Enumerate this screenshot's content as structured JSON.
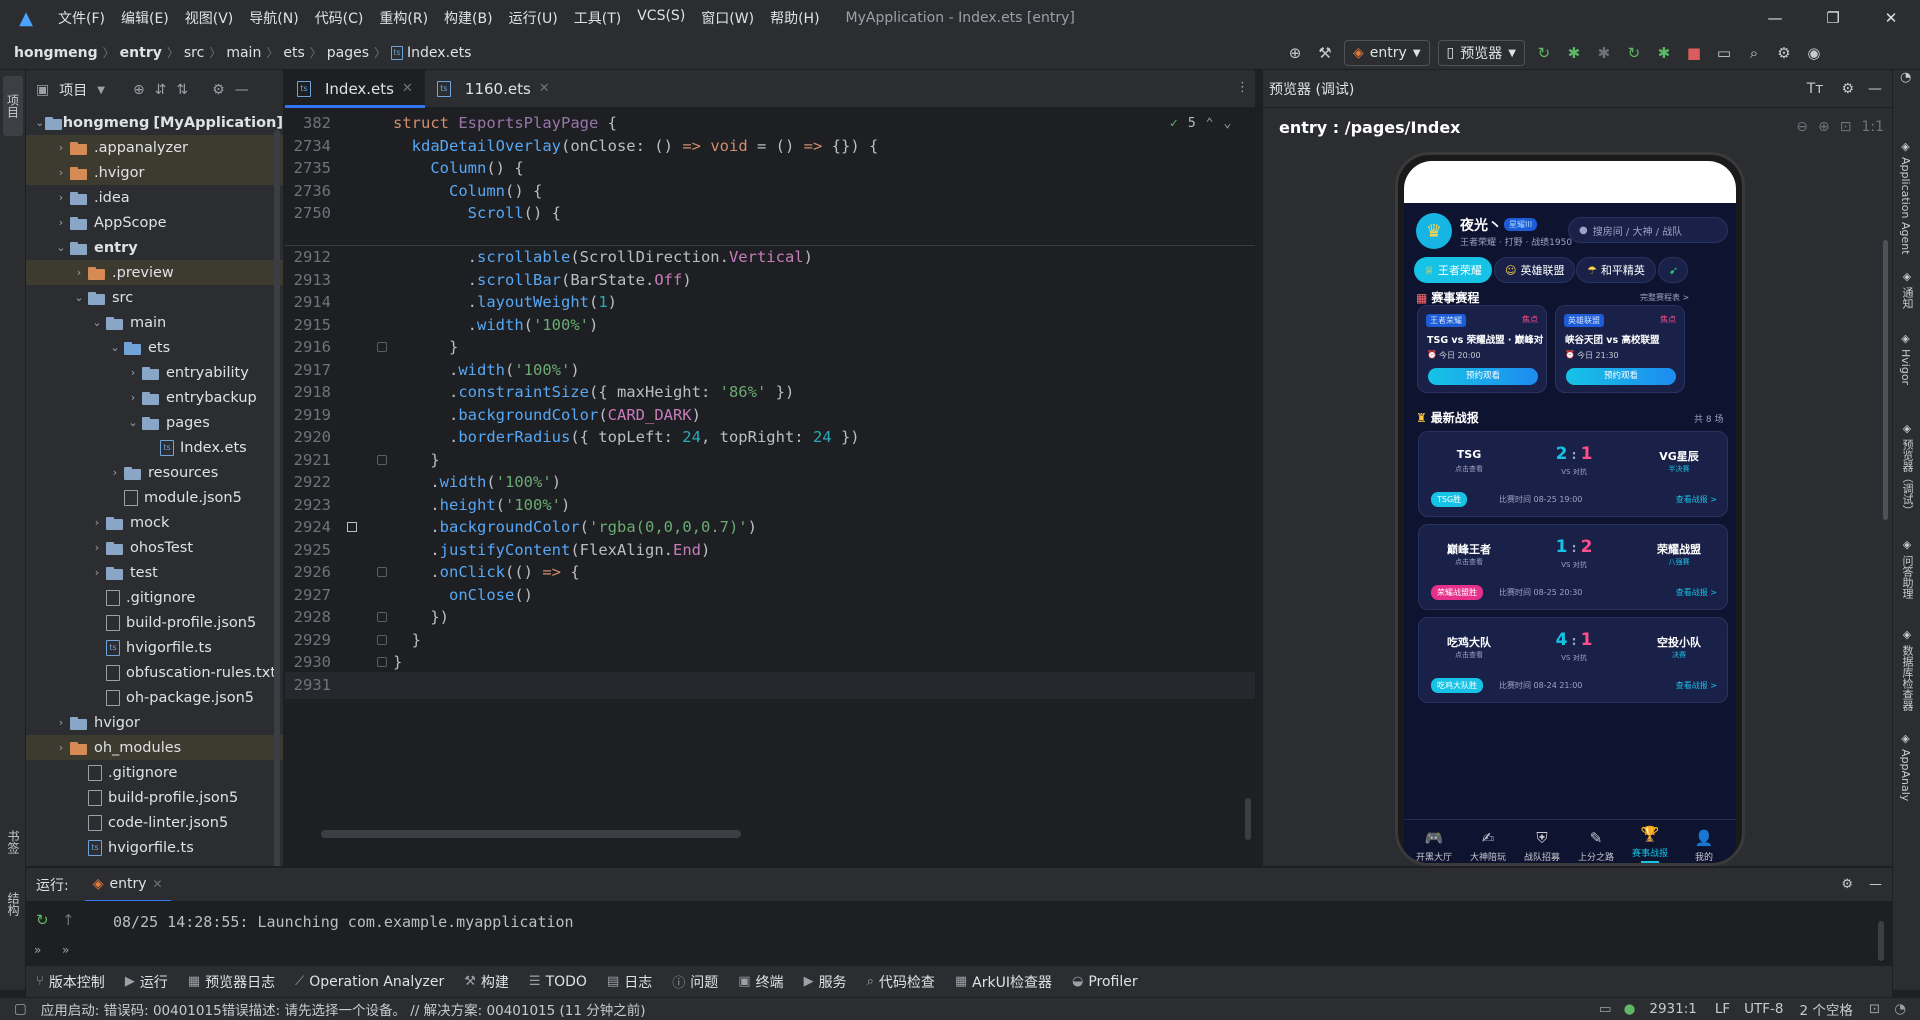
{
  "menubar": {
    "items": [
      "文件(F)",
      "编辑(E)",
      "视图(V)",
      "导航(N)",
      "代码(C)",
      "重构(R)",
      "构建(B)",
      "运行(U)",
      "工具(T)",
      "VCS(S)",
      "窗口(W)",
      "帮助(H)"
    ],
    "window_title": "MyApplication - Index.ets [entry]"
  },
  "breadcrumb": [
    "hongmeng",
    "entry",
    "src",
    "main",
    "ets",
    "pages",
    "Index.ets"
  ],
  "toolbar": {
    "run_config": "entry",
    "device": "预览器"
  },
  "project_panel": {
    "title": "项目",
    "tree": [
      {
        "label": "hongmeng",
        "suffix": "[MyApplication]",
        "depth": 0,
        "type": "folder",
        "open": true
      },
      {
        "label": ".appanalyzer",
        "depth": 1,
        "type": "folder-orange",
        "open": false,
        "hl": true
      },
      {
        "label": ".hvigor",
        "depth": 1,
        "type": "folder-orange",
        "open": false,
        "hl": true
      },
      {
        "label": ".idea",
        "depth": 1,
        "type": "folder",
        "open": false
      },
      {
        "label": "AppScope",
        "depth": 1,
        "type": "folder",
        "open": false
      },
      {
        "label": "entry",
        "depth": 1,
        "type": "folder",
        "open": true,
        "bold": true
      },
      {
        "label": ".preview",
        "depth": 2,
        "type": "folder-orange",
        "open": false,
        "hl": true
      },
      {
        "label": "src",
        "depth": 2,
        "type": "folder",
        "open": true
      },
      {
        "label": "main",
        "depth": 3,
        "type": "folder",
        "open": true
      },
      {
        "label": "ets",
        "depth": 4,
        "type": "folder-blue",
        "open": true
      },
      {
        "label": "entryability",
        "depth": 5,
        "type": "folder",
        "open": false
      },
      {
        "label": "entrybackup",
        "depth": 5,
        "type": "folder",
        "open": false
      },
      {
        "label": "pages",
        "depth": 5,
        "type": "folder",
        "open": true
      },
      {
        "label": "Index.ets",
        "depth": 6,
        "type": "file-ts",
        "leaf": true
      },
      {
        "label": "resources",
        "depth": 4,
        "type": "folder",
        "open": false
      },
      {
        "label": "module.json5",
        "depth": 4,
        "type": "file",
        "leaf": true
      },
      {
        "label": "mock",
        "depth": 3,
        "type": "folder",
        "open": false
      },
      {
        "label": "ohosTest",
        "depth": 3,
        "type": "folder",
        "open": false
      },
      {
        "label": "test",
        "depth": 3,
        "type": "folder",
        "open": false
      },
      {
        "label": ".gitignore",
        "depth": 3,
        "type": "file",
        "leaf": true
      },
      {
        "label": "build-profile.json5",
        "depth": 3,
        "type": "file",
        "leaf": true
      },
      {
        "label": "hvigorfile.ts",
        "depth": 3,
        "type": "file-ts",
        "leaf": true
      },
      {
        "label": "obfuscation-rules.txt",
        "depth": 3,
        "type": "file",
        "leaf": true
      },
      {
        "label": "oh-package.json5",
        "depth": 3,
        "type": "file",
        "leaf": true
      },
      {
        "label": "hvigor",
        "depth": 1,
        "type": "folder",
        "open": false
      },
      {
        "label": "oh_modules",
        "depth": 1,
        "type": "folder-orange",
        "open": false,
        "hl": true
      },
      {
        "label": ".gitignore",
        "depth": 2,
        "type": "file",
        "leaf": true
      },
      {
        "label": "build-profile.json5",
        "depth": 2,
        "type": "file",
        "leaf": true
      },
      {
        "label": "code-linter.json5",
        "depth": 2,
        "type": "file",
        "leaf": true
      },
      {
        "label": "hvigorfile.ts",
        "depth": 2,
        "type": "file-ts",
        "leaf": true
      }
    ]
  },
  "editor_tabs": [
    {
      "label": "Index.ets",
      "active": true
    },
    {
      "label": "1160.ets",
      "active": false
    }
  ],
  "editor": {
    "inspection_count": "5",
    "sticky_lines": [
      {
        "num": "382",
        "html": "<span class='kw'>struct</span> <span class='ty'>EsportsPlayPage</span> {"
      },
      {
        "num": "2734",
        "html": "  <span class='fn'>kdaDetailOverlay</span>(onClose: () <span class='kw'>=&gt;</span> <span class='kw'>void</span> = () <span class='kw'>=&gt;</span> {}) {"
      },
      {
        "num": "2735",
        "html": "    <span class='fn'>Column</span>() {"
      },
      {
        "num": "2736",
        "html": "      <span class='fn'>Column</span>() {"
      },
      {
        "num": "2750",
        "html": "        <span class='fn'>Scroll</span>() {"
      }
    ],
    "lines": [
      {
        "num": "2912",
        "html": "        .<span class='fn'>scrollable</span>(ScrollDirection.<span class='cn'>Vertical</span>)"
      },
      {
        "num": "2913",
        "html": "        .<span class='fn'>scrollBar</span>(BarState.<span class='cn'>Off</span>)"
      },
      {
        "num": "2914",
        "html": "        .<span class='fn'>layoutWeight</span>(<span class='num'>1</span>)"
      },
      {
        "num": "2915",
        "html": "        .<span class='fn'>width</span>(<span class='str'>'100%'</span>)"
      },
      {
        "num": "2916",
        "html": "      }"
      },
      {
        "num": "2917",
        "html": "      .<span class='fn'>width</span>(<span class='str'>'100%'</span>)"
      },
      {
        "num": "2918",
        "html": "      .<span class='fn'>constraintSize</span>({ maxHeight: <span class='str'>'86%'</span> })"
      },
      {
        "num": "2919",
        "html": "      .<span class='fn'>backgroundColor</span>(<span class='cn'>CARD_DARK</span>)"
      },
      {
        "num": "2920",
        "html": "      .<span class='fn'>borderRadius</span>({ topLeft: <span class='num'>24</span>, topRight: <span class='num'>24</span> })"
      },
      {
        "num": "2921",
        "html": "    }"
      },
      {
        "num": "2922",
        "html": "    .<span class='fn'>width</span>(<span class='str'>'100%'</span>)"
      },
      {
        "num": "2923",
        "html": "    .<span class='fn'>height</span>(<span class='str'>'100%'</span>)"
      },
      {
        "num": "2924",
        "html": "    .<span class='fn'>backgroundColor</span>(<span class='str'>'rgba(0,0,0,0.7)'</span>)"
      },
      {
        "num": "2925",
        "html": "    .<span class='fn'>justifyContent</span>(FlexAlign.<span class='cn'>End</span>)"
      },
      {
        "num": "2926",
        "html": "    .<span class='fn'>onClick</span>(() <span class='kw'>=&gt;</span> {"
      },
      {
        "num": "2927",
        "html": "      <span class='fn'>onClose</span>()"
      },
      {
        "num": "2928",
        "html": "    })"
      },
      {
        "num": "2929",
        "html": "  }"
      },
      {
        "num": "2930",
        "html": "}"
      },
      {
        "num": "2931",
        "html": ""
      }
    ]
  },
  "preview": {
    "header": "预览器 (调试)",
    "path": "entry : /pages/Index",
    "app": {
      "user_name": "夜光丶",
      "user_badge": "星耀III",
      "user_sub": "王者荣耀 · 打野 · 战绩1950",
      "search_placeholder": "搜房间 / 大神 / 战队",
      "game_tabs": [
        "王者荣耀",
        "英雄联盟",
        "和平精英"
      ],
      "schedule_title": "赛事赛程",
      "schedule_link": "完整赛程表 >",
      "matches": [
        {
          "tag": "王者荣耀",
          "hot": "焦点",
          "title": "TSG vs 荣耀战盟 · 巅峰对",
          "time": "今日 20:00",
          "btn": "预约观看"
        },
        {
          "tag": "英雄联盟",
          "hot": "焦点",
          "title": "峡谷天团 vs 高校联盟",
          "time": "今日 21:30",
          "btn": "预约观看"
        }
      ],
      "results_title": "最新战报",
      "results_count": "共 8 场",
      "results": [
        {
          "team_a": "TSG",
          "a_sub": "点击查看",
          "score_a": "2",
          "score_b": "1",
          "vs": "VS 对抗",
          "team_b": "VG星辰",
          "b_sub": "半决赛",
          "winner": "TSG胜",
          "winner_color": "#16c3e6",
          "time": "比赛时间 08-25 19:00",
          "link": "查看战报 >"
        },
        {
          "team_a": "巅峰王者",
          "a_sub": "点击查看",
          "score_a": "1",
          "score_b": "2",
          "vs": "VS 对抗",
          "team_b": "荣耀战盟",
          "b_sub": "八强赛",
          "winner": "荣耀战盟胜",
          "winner_color": "#e6308a",
          "time": "比赛时间 08-25 20:30",
          "link": "查看战报 >"
        },
        {
          "team_a": "吃鸡大队",
          "a_sub": "点击查看",
          "score_a": "4",
          "score_b": "1",
          "vs": "VS 对抗",
          "team_b": "空投小队",
          "b_sub": "决赛",
          "winner": "吃鸡大队胜",
          "winner_color": "#16c3e6",
          "time": "比赛时间 08-24 21:00",
          "link": "查看战报 >"
        }
      ],
      "bottom_tabs": [
        "开黑大厅",
        "大神陪玩",
        "战队招募",
        "上分之路",
        "赛事战报",
        "我的"
      ],
      "active_tab": 4
    }
  },
  "left_strip": {
    "project_label": "项目",
    "bookmarks_label": "书签",
    "structure_label": "结构"
  },
  "right_strip": [
    "Application Agent",
    "通知",
    "Hvigor",
    "预览器（调试）",
    "问答助理",
    "数据库检查器",
    "AppAnaly"
  ],
  "run_panel": {
    "label": "运行:",
    "config": "entry",
    "log": "08/25 14:28:55: Launching com.example.myapplication"
  },
  "bottom_tools": [
    "版本控制",
    "运行",
    "预览器日志",
    "Operation Analyzer",
    "构建",
    "TODO",
    "日志",
    "问题",
    "终端",
    "服务",
    "代码检查",
    "ArkUI检查器",
    "Profiler"
  ],
  "status": {
    "message": "应用启动: 错误码: 00401015错误描述: 请先选择一个设备。 // 解决方案: 00401015 (11 分钟之前)",
    "position": "2931:1",
    "line_sep": "LF",
    "encoding": "UTF-8",
    "indent": "2 个空格"
  }
}
